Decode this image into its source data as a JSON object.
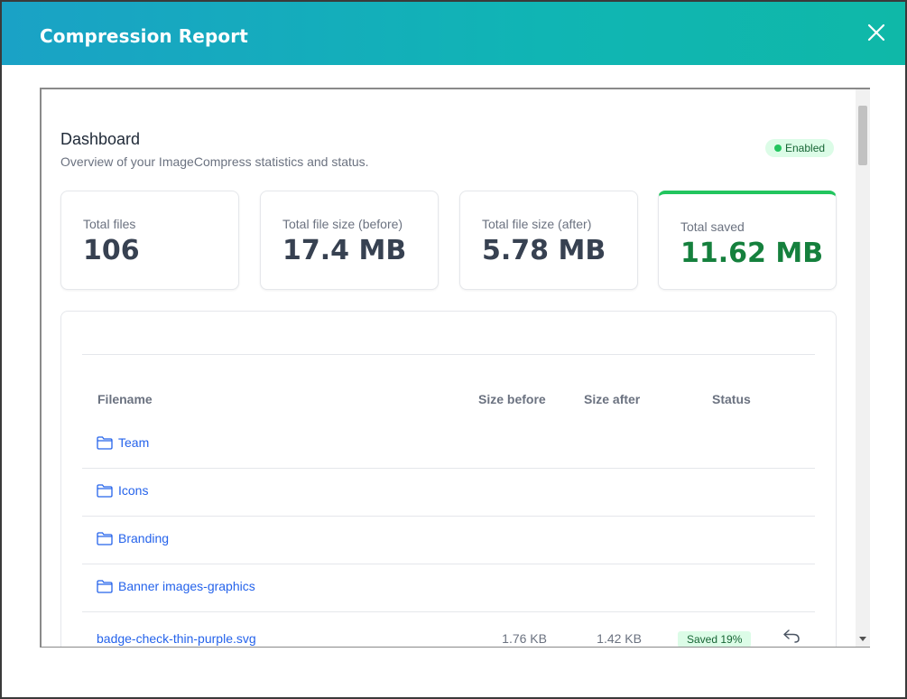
{
  "modal": {
    "title": "Compression Report"
  },
  "dashboard": {
    "title": "Dashboard",
    "subtitle": "Overview of your ImageCompress statistics and status.",
    "status": "Enabled"
  },
  "stats": [
    {
      "label": "Total files",
      "value": "106"
    },
    {
      "label": "Total file size (before)",
      "value": "17.4 MB"
    },
    {
      "label": "Total file size (after)",
      "value": "5.78 MB"
    },
    {
      "label": "Total saved",
      "value": "11.62 MB"
    }
  ],
  "table": {
    "headers": {
      "filename": "Filename",
      "size_before": "Size before",
      "size_after": "Size after",
      "status": "Status"
    },
    "folders": [
      "Team",
      "Icons",
      "Branding",
      "Banner images-graphics"
    ],
    "files": [
      {
        "name": "badge-check-thin-purple.svg",
        "size_before": "1.76 KB",
        "size_after": "1.42 KB",
        "status": "Saved 19%"
      }
    ]
  },
  "colors": {
    "header_start": "#1aa2c6",
    "header_end": "#0fb8a8",
    "saved_green": "#15803d",
    "link_blue": "#2563eb"
  }
}
